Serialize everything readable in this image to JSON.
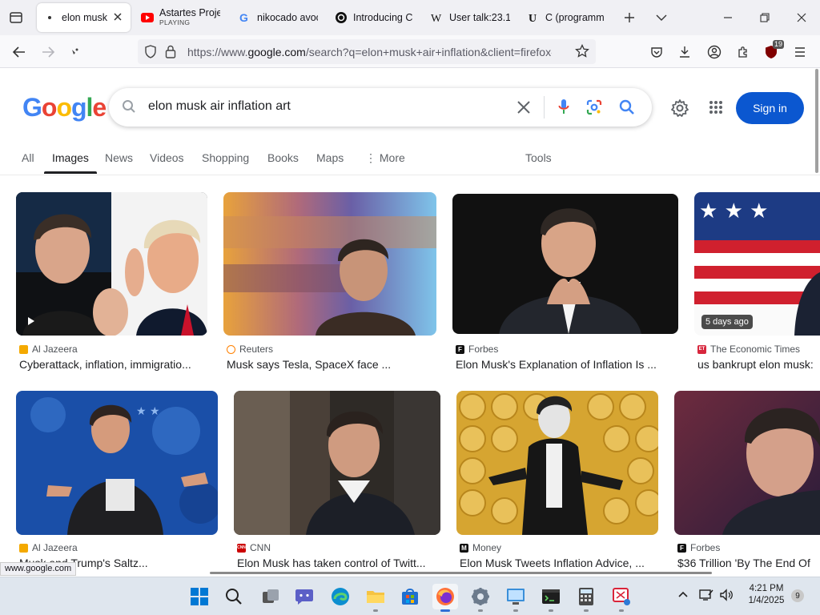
{
  "browser": {
    "tabs": [
      {
        "title": "elon musk",
        "subtitle": "",
        "icon": "google-icon",
        "active": true
      },
      {
        "title": "Astartes Proje",
        "subtitle": "PLAYING",
        "icon": "youtube-icon"
      },
      {
        "title": "nikocado avoc",
        "subtitle": "",
        "icon": "google-icon"
      },
      {
        "title": "Introducing C",
        "subtitle": "",
        "icon": "openai-icon"
      },
      {
        "title": "User talk:23.1",
        "subtitle": "",
        "icon": "wikipedia-icon"
      },
      {
        "title": "C (programm",
        "subtitle": "",
        "icon": "wikibooks-icon"
      }
    ],
    "url_prefix": "https://www.",
    "url_domain": "google.com",
    "url_rest": "/search?q=elon+musk+air+inflation&client=firefox-b",
    "extension_badge": "19",
    "status_url": "www.google.com"
  },
  "google": {
    "logo_text": [
      "G",
      "o",
      "o",
      "g",
      "l",
      "e"
    ],
    "logo_colors": [
      "#4285f4",
      "#ea4335",
      "#fbbc05",
      "#4285f4",
      "#34a853",
      "#ea4335"
    ],
    "query": "elon musk air inflation art",
    "signin_label": "Sign in",
    "tabs": [
      "All",
      "Images",
      "News",
      "Videos",
      "Shopping",
      "Books",
      "Maps",
      "More"
    ],
    "active_tab": "Images",
    "tools_label": "Tools"
  },
  "results": [
    {
      "source": "Al Jazeera",
      "caption": "Cyberattack, inflation, immigratio...",
      "fav_color": "#f4a900",
      "fav_letter": ""
    },
    {
      "source": "Reuters",
      "caption": "Musk says Tesla, SpaceX face ...",
      "fav_color": "#ff8000",
      "fav_letter": ""
    },
    {
      "source": "Forbes",
      "caption": "Elon Musk's Explanation of Inflation Is ...",
      "fav_color": "#111111",
      "fav_letter": "F"
    },
    {
      "source": "The Economic Times",
      "caption": "us bankrupt elon musk:",
      "fav_color": "#d7263d",
      "fav_letter": "ET",
      "badge": "5 days ago"
    },
    {
      "source": "Al Jazeera",
      "caption": "Musk and Trump's Saltz...",
      "fav_color": "#f4a900",
      "fav_letter": ""
    },
    {
      "source": "CNN",
      "caption": "Elon Musk has taken control of Twitt...",
      "fav_color": "#cc0000",
      "fav_letter": "CNN"
    },
    {
      "source": "Money",
      "caption": "Elon Musk Tweets Inflation Advice, ...",
      "fav_color": "#111111",
      "fav_letter": "M"
    },
    {
      "source": "Forbes",
      "caption": "$36 Trillion 'By The End Of",
      "fav_color": "#111111",
      "fav_letter": "F"
    }
  ],
  "taskbar": {
    "time": "4:21 PM",
    "date": "1/4/2025",
    "notifications": "9"
  }
}
